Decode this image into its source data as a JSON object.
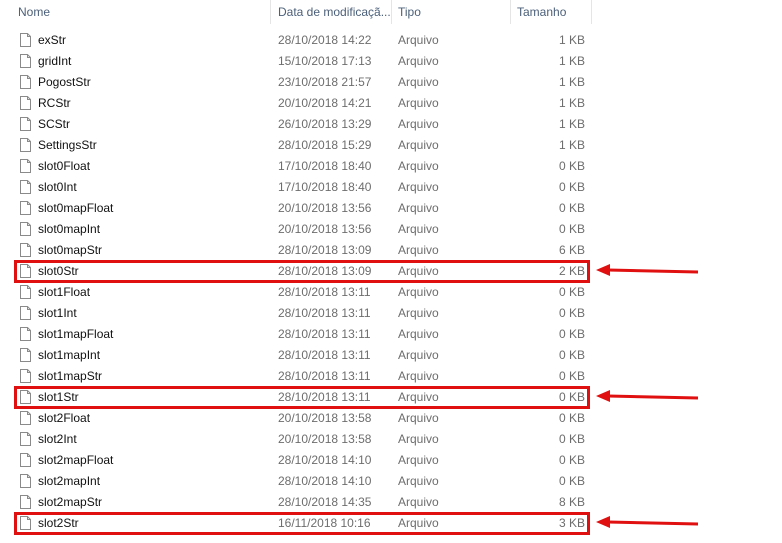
{
  "columns": {
    "name": "Nome",
    "date": "Data de modificaçã...",
    "type": "Tipo",
    "size": "Tamanho"
  },
  "files": [
    {
      "name": "exStr",
      "date": "28/10/2018 14:22",
      "type": "Arquivo",
      "size": "1 KB"
    },
    {
      "name": "gridInt",
      "date": "15/10/2018 17:13",
      "type": "Arquivo",
      "size": "1 KB"
    },
    {
      "name": "PogostStr",
      "date": "23/10/2018 21:57",
      "type": "Arquivo",
      "size": "1 KB"
    },
    {
      "name": "RCStr",
      "date": "20/10/2018 14:21",
      "type": "Arquivo",
      "size": "1 KB"
    },
    {
      "name": "SCStr",
      "date": "26/10/2018 13:29",
      "type": "Arquivo",
      "size": "1 KB"
    },
    {
      "name": "SettingsStr",
      "date": "28/10/2018 15:29",
      "type": "Arquivo",
      "size": "1 KB"
    },
    {
      "name": "slot0Float",
      "date": "17/10/2018 18:40",
      "type": "Arquivo",
      "size": "0 KB"
    },
    {
      "name": "slot0Int",
      "date": "17/10/2018 18:40",
      "type": "Arquivo",
      "size": "0 KB"
    },
    {
      "name": "slot0mapFloat",
      "date": "20/10/2018 13:56",
      "type": "Arquivo",
      "size": "0 KB"
    },
    {
      "name": "slot0mapInt",
      "date": "20/10/2018 13:56",
      "type": "Arquivo",
      "size": "0 KB"
    },
    {
      "name": "slot0mapStr",
      "date": "28/10/2018 13:09",
      "type": "Arquivo",
      "size": "6 KB"
    },
    {
      "name": "slot0Str",
      "date": "28/10/2018 13:09",
      "type": "Arquivo",
      "size": "2 KB"
    },
    {
      "name": "slot1Float",
      "date": "28/10/2018 13:11",
      "type": "Arquivo",
      "size": "0 KB"
    },
    {
      "name": "slot1Int",
      "date": "28/10/2018 13:11",
      "type": "Arquivo",
      "size": "0 KB"
    },
    {
      "name": "slot1mapFloat",
      "date": "28/10/2018 13:11",
      "type": "Arquivo",
      "size": "0 KB"
    },
    {
      "name": "slot1mapInt",
      "date": "28/10/2018 13:11",
      "type": "Arquivo",
      "size": "0 KB"
    },
    {
      "name": "slot1mapStr",
      "date": "28/10/2018 13:11",
      "type": "Arquivo",
      "size": "0 KB"
    },
    {
      "name": "slot1Str",
      "date": "28/10/2018 13:11",
      "type": "Arquivo",
      "size": "0 KB"
    },
    {
      "name": "slot2Float",
      "date": "20/10/2018 13:58",
      "type": "Arquivo",
      "size": "0 KB"
    },
    {
      "name": "slot2Int",
      "date": "20/10/2018 13:58",
      "type": "Arquivo",
      "size": "0 KB"
    },
    {
      "name": "slot2mapFloat",
      "date": "28/10/2018 14:10",
      "type": "Arquivo",
      "size": "0 KB"
    },
    {
      "name": "slot2mapInt",
      "date": "28/10/2018 14:10",
      "type": "Arquivo",
      "size": "0 KB"
    },
    {
      "name": "slot2mapStr",
      "date": "28/10/2018 14:35",
      "type": "Arquivo",
      "size": "8 KB"
    },
    {
      "name": "slot2Str",
      "date": "16/11/2018 10:16",
      "type": "Arquivo",
      "size": "3 KB"
    }
  ],
  "highlighted_files": [
    "slot0Str",
    "slot1Str",
    "slot2Str"
  ],
  "icons": {
    "file": "file-icon",
    "sort": "sort-caret-icon",
    "annotation": "arrow-left-icon"
  },
  "colors": {
    "annotation": "#e01010",
    "header_text": "#4c607a",
    "muted_text": "#6d6d6d"
  }
}
